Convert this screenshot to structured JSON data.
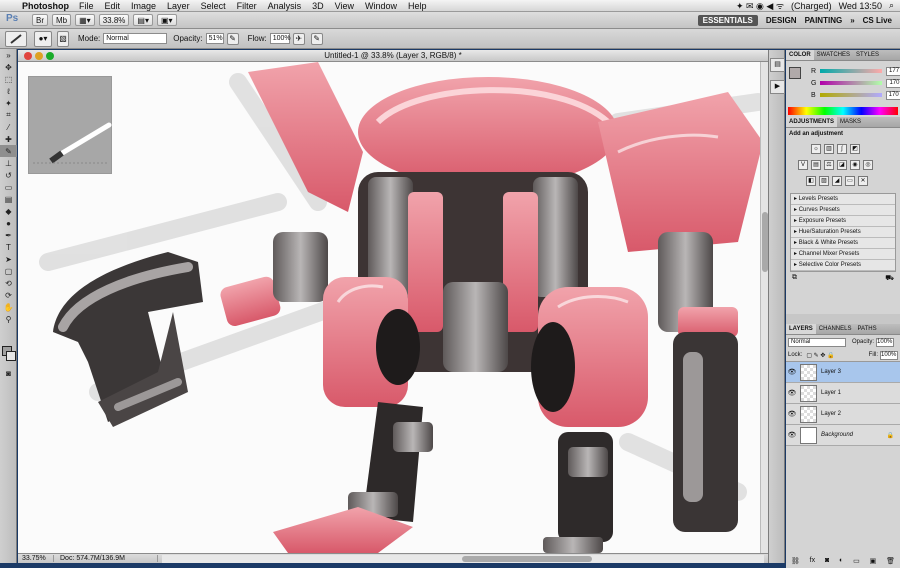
{
  "menubar": {
    "apple": "",
    "app_name": "Photoshop",
    "items": [
      "File",
      "Edit",
      "Image",
      "Layer",
      "Select",
      "Filter",
      "Analysis",
      "3D",
      "View",
      "Window",
      "Help"
    ],
    "status_icons": "✦ ✉ ◉ ◀ ᯤ",
    "battery": "(Charged)",
    "clock": "Wed 13:50"
  },
  "appbar": {
    "logo": "Ps",
    "zoom": "33.8%",
    "workspaces": [
      "ESSENTIALS",
      "DESIGN",
      "PAINTING"
    ],
    "overflow": "»",
    "cslive": "CS Live"
  },
  "options": {
    "mode_label": "Mode:",
    "mode_value": "Normal",
    "opacity_label": "Opacity:",
    "opacity_value": "51%",
    "flow_label": "Flow:",
    "flow_value": "100%"
  },
  "document": {
    "title": "Untitled-1 @ 33.8% (Layer 3, RGB/8) *",
    "zoom_status": "33.75%",
    "doc_status": "Doc: 574.7M/136.9M"
  },
  "color_panel": {
    "tabs": [
      "COLOR",
      "SWATCHES",
      "STYLES"
    ],
    "channels": [
      {
        "label": "R",
        "value": "177"
      },
      {
        "label": "G",
        "value": "170"
      },
      {
        "label": "B",
        "value": "170"
      }
    ]
  },
  "adjustments_panel": {
    "tabs": [
      "ADJUSTMENTS",
      "MASKS"
    ],
    "heading": "Add an adjustment",
    "presets": [
      "Levels Presets",
      "Curves Presets",
      "Exposure Presets",
      "Hue/Saturation Presets",
      "Black & White Presets",
      "Channel Mixer Presets",
      "Selective Color Presets"
    ]
  },
  "layers_panel": {
    "tabs": [
      "LAYERS",
      "CHANNELS",
      "PATHS"
    ],
    "blend_mode": "Normal",
    "opacity_label": "Opacity:",
    "opacity_value": "100%",
    "lock_label": "Lock:",
    "fill_label": "Fill:",
    "fill_value": "100%",
    "layers": [
      "Layer 3",
      "Layer 1",
      "Layer 2",
      "Background"
    ]
  }
}
